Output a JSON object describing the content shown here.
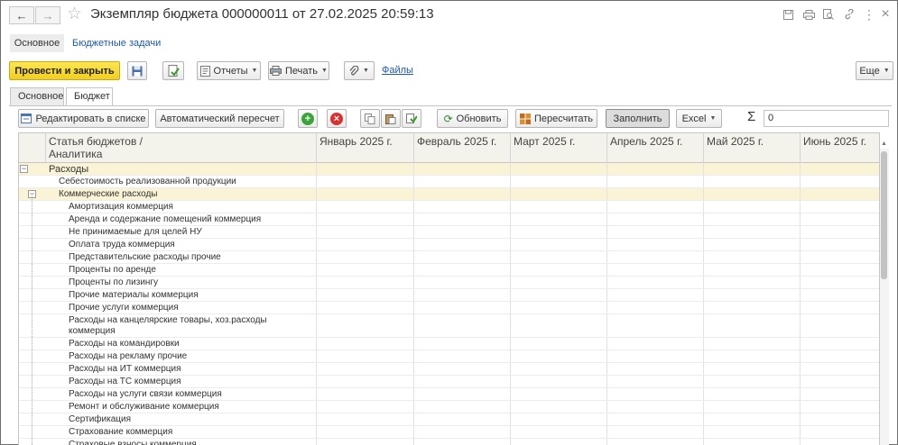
{
  "window": {
    "title": "Экземпляр бюджета 000000011 от 27.02.2025 20:59:13",
    "back": "←",
    "forward": "→",
    "star": "☆",
    "icons": [
      "save-icon",
      "print-icon",
      "preview-icon",
      "link-icon",
      "more-icon",
      "close-icon"
    ],
    "glyphs": {
      "more": "⋮",
      "close": "×",
      "link": "⚲"
    }
  },
  "top_tabs": {
    "main": "Основное",
    "tasks": "Бюджетные задачи"
  },
  "toolbar": {
    "post_close": "Провести и закрыть",
    "reports": "Отчеты",
    "print": "Печать",
    "files": "Файлы",
    "more": "Еще",
    "dropdown_arrow": "▼"
  },
  "inner_tabs": {
    "main": "Основное",
    "budget": "Бюджет"
  },
  "budget_toolbar": {
    "edit_list": "Редактировать в списке",
    "auto_recalc": "Автоматический пересчет",
    "add": "+",
    "remove": "×",
    "refresh": "Обновить",
    "recalculate": "Пересчитать",
    "fill": "Заполнить",
    "excel": "Excel",
    "sigma": "Σ",
    "sum_value": "0"
  },
  "grid": {
    "columns": [
      "Статья бюджетов /\nАналитика",
      "Январь 2025 г.",
      "Февраль 2025 г.",
      "Март 2025 г.",
      "Апрель 2025 г.",
      "Май 2025 г.",
      "Июнь 2025 г."
    ],
    "rows": [
      {
        "label": "Расходы",
        "level": 0,
        "group": true,
        "toggle": "−"
      },
      {
        "label": "Себестоимость реализованной продукции",
        "level": 1,
        "group": false
      },
      {
        "label": "Коммерческие расходы",
        "level": 1,
        "group": true,
        "toggle": "−"
      },
      {
        "label": "Амортизация коммерция",
        "level": 2,
        "group": false
      },
      {
        "label": "Аренда и содержание помещений коммерция",
        "level": 2,
        "group": false
      },
      {
        "label": "Не принимаемые для целей НУ",
        "level": 2,
        "group": false
      },
      {
        "label": "Оплата труда коммерция",
        "level": 2,
        "group": false
      },
      {
        "label": "Представительские расходы прочие",
        "level": 2,
        "group": false
      },
      {
        "label": "Проценты по аренде",
        "level": 2,
        "group": false
      },
      {
        "label": "Проценты по лизингу",
        "level": 2,
        "group": false
      },
      {
        "label": "Прочие материалы коммерция",
        "level": 2,
        "group": false
      },
      {
        "label": "Прочие услуги коммерция",
        "level": 2,
        "group": false
      },
      {
        "label": "Расходы на канцелярские товары, хоз.расходы\nкоммерция",
        "level": 2,
        "group": false,
        "tall": true
      },
      {
        "label": "Расходы на командировки",
        "level": 2,
        "group": false
      },
      {
        "label": "Расходы на рекламу прочие",
        "level": 2,
        "group": false
      },
      {
        "label": "Расходы на ИТ коммерция",
        "level": 2,
        "group": false
      },
      {
        "label": "Расходы на ТС коммерция",
        "level": 2,
        "group": false
      },
      {
        "label": "Расходы на услуги связи коммерция",
        "level": 2,
        "group": false
      },
      {
        "label": "Ремонт и обслуживание коммерция",
        "level": 2,
        "group": false
      },
      {
        "label": "Сертификация",
        "level": 2,
        "group": false
      },
      {
        "label": "Страхование коммерция",
        "level": 2,
        "group": false
      },
      {
        "label": "Страховые взносы коммерция",
        "level": 2,
        "group": false
      }
    ]
  }
}
